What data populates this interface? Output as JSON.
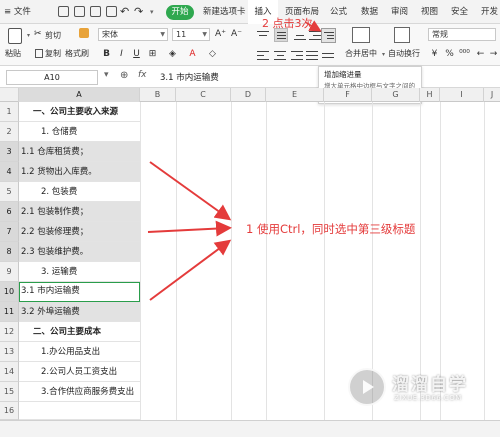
{
  "menubar": {
    "file": "≡ 文件",
    "tabs": [
      "开始",
      "新建选项卡",
      "插入",
      "页面布局",
      "公式",
      "数据",
      "审阅",
      "视图",
      "安全",
      "开发"
    ]
  },
  "ribbon": {
    "paste": "粘贴",
    "cut": "剪切",
    "copy": "复制",
    "format_painter": "格式刷",
    "font_name": "宋体",
    "font_size": "11",
    "merge_center": "合并居中",
    "wrap_text": "自动换行",
    "number_format": "常规"
  },
  "formula_bar": {
    "name_box": "A10",
    "fx": "fx",
    "content": "3.1 市内运输费"
  },
  "tooltip": {
    "title": "增加缩进量",
    "desc": "增大单元格中边框与文字之间的距离。"
  },
  "annotations": {
    "click_hint": "2 点击3次",
    "select_hint": "1 使用Ctrl，同时选中第三级标题"
  },
  "columns": [
    "A",
    "B",
    "C",
    "D",
    "E",
    "F",
    "G",
    "H",
    "I",
    "J"
  ],
  "rows": [
    {
      "num": "1",
      "text": "一、公司主要收入来源"
    },
    {
      "num": "2",
      "text": "1. 仓储费"
    },
    {
      "num": "3",
      "text": "1.1 仓库租赁费；"
    },
    {
      "num": "4",
      "text": "1.2 货物出入库费。"
    },
    {
      "num": "5",
      "text": "2. 包装费"
    },
    {
      "num": "6",
      "text": "2.1 包装制作费；"
    },
    {
      "num": "7",
      "text": "2.2 包装修理费；"
    },
    {
      "num": "8",
      "text": "2.3 包装维护费。"
    },
    {
      "num": "9",
      "text": "3. 运输费"
    },
    {
      "num": "10",
      "text": "3.1 市内运输费"
    },
    {
      "num": "11",
      "text": "3.2 外埠运输费"
    },
    {
      "num": "12",
      "text": "二、公司主要成本"
    },
    {
      "num": "13",
      "text": "1.办公用品支出"
    },
    {
      "num": "14",
      "text": "2.公司人员工资支出"
    },
    {
      "num": "15",
      "text": "3.合作供应商服务费支出"
    },
    {
      "num": "16",
      "text": ""
    }
  ],
  "watermark": {
    "title": "溜溜自学",
    "url": "ZIXUE.3D66.COM"
  },
  "colors": {
    "accent": "#2fa84f",
    "annotation": "#e43b3b",
    "selection": "#e2e2e2"
  }
}
